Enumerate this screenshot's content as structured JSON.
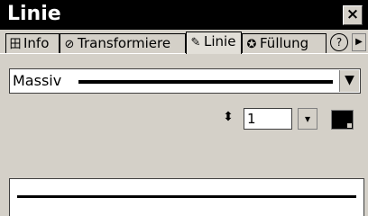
{
  "window": {
    "title": "Linie",
    "close_glyph": "×"
  },
  "tabs": [
    {
      "label": "Info",
      "icon": "info-icon",
      "glyph": "田",
      "active": false
    },
    {
      "label": "Transformiere",
      "icon": "transform-icon",
      "glyph": "⊘",
      "active": false
    },
    {
      "label": "Linie",
      "icon": "pen-icon",
      "glyph": "✎",
      "active": true
    },
    {
      "label": "Füllung",
      "icon": "fill-icon",
      "glyph": "✪",
      "active": false
    }
  ],
  "help_glyph": "?",
  "scroll_glyph": "▶",
  "line_style": {
    "value": "Massiv",
    "dropdown_glyph": "▼"
  },
  "line_width": {
    "value": "1",
    "icon_glyph": "⬍",
    "dropdown_glyph": "▾"
  },
  "line_color": "#000000"
}
